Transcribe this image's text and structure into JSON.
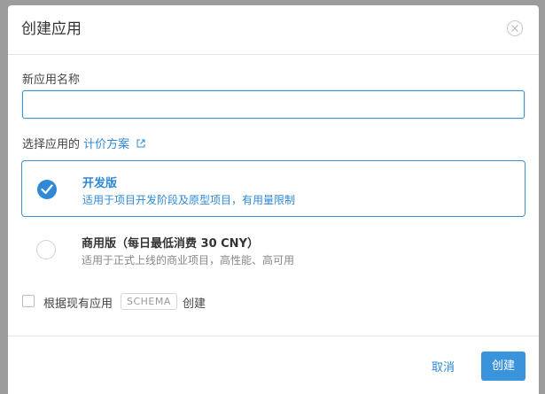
{
  "dialog": {
    "title": "创建应用",
    "close_icon": "close-icon"
  },
  "name_field": {
    "label": "新应用名称",
    "value": "",
    "placeholder": ""
  },
  "plan": {
    "prefix": "选择应用的",
    "link_label": "计价方案",
    "link_icon": "external-link-icon"
  },
  "options": [
    {
      "title": "开发版",
      "description": "适用于项目开发阶段及原型项目，有用量限制",
      "selected": true
    },
    {
      "title": "商用版（每日最低消费 30 CNY）",
      "description": "适用于正式上线的商业项目，高性能、高可用",
      "selected": false
    }
  ],
  "schema": {
    "checked": false,
    "label_before": "根据现有应用",
    "tag": "SCHEMA",
    "label_after": "创建"
  },
  "footer": {
    "cancel_label": "取消",
    "create_label": "创建"
  },
  "colors": {
    "accent": "#2f89d6",
    "backdrop": "#9c9c9c"
  }
}
